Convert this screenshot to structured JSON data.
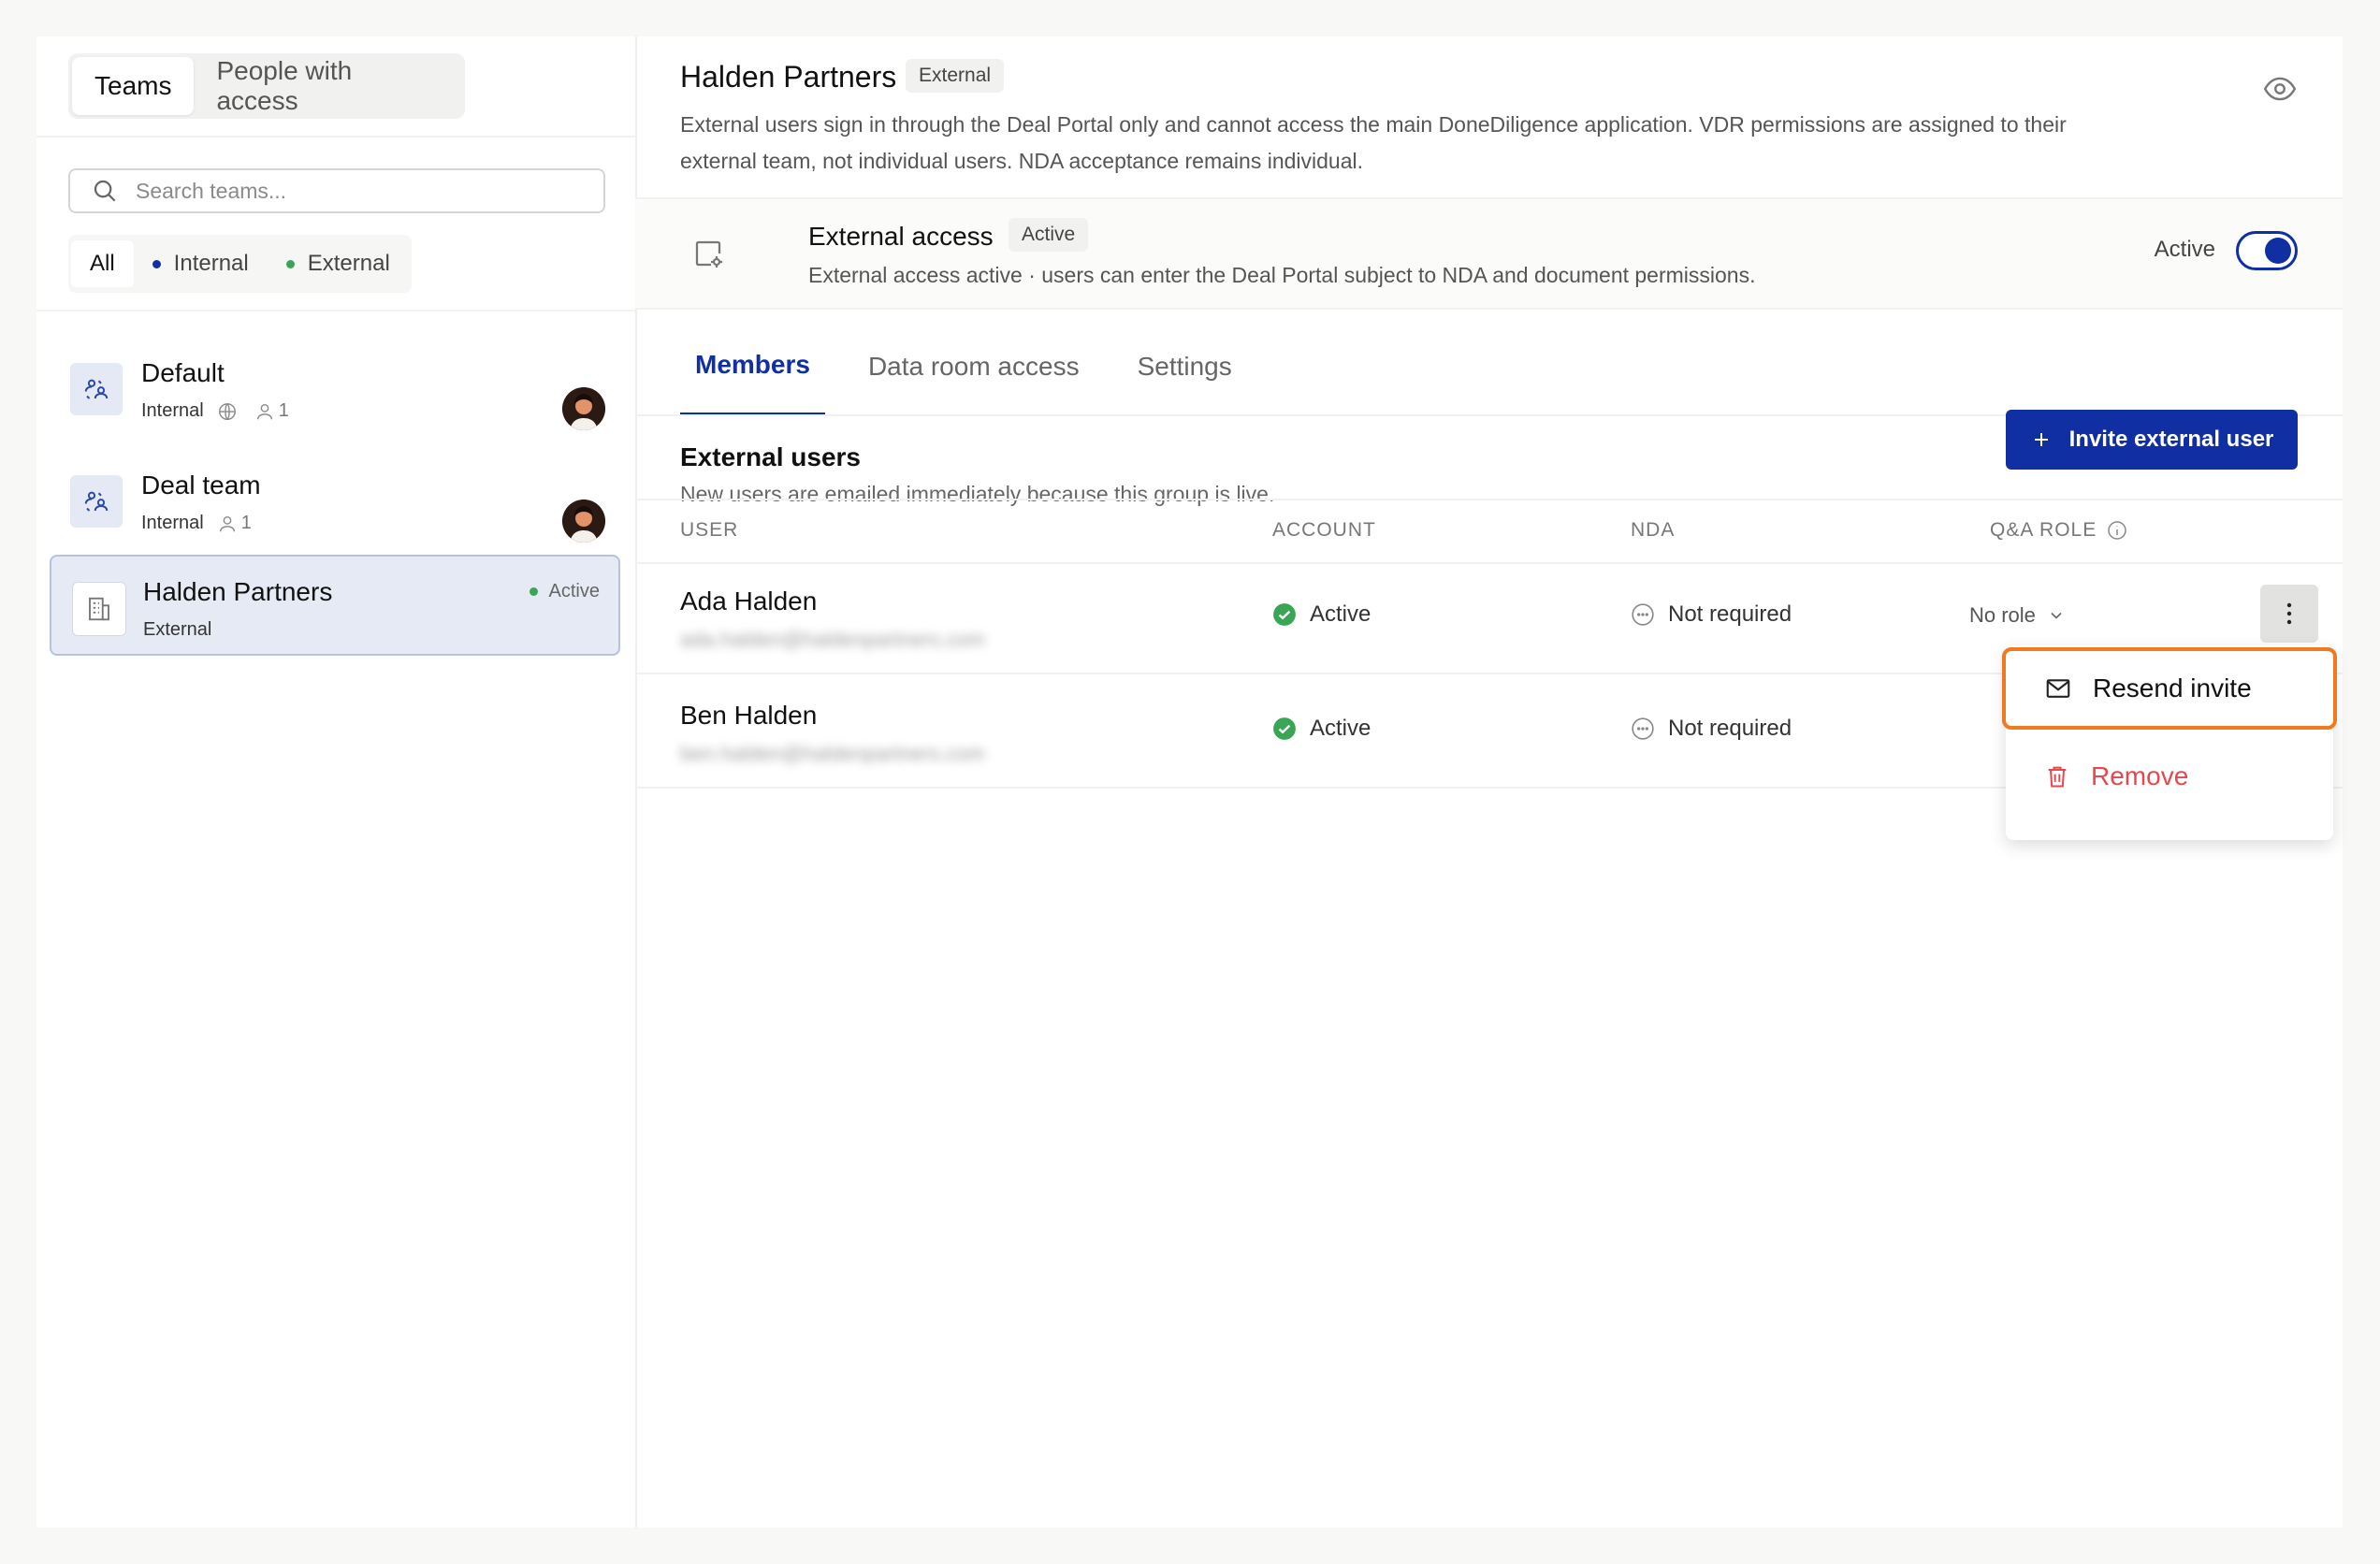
{
  "sidebar": {
    "tabs": [
      {
        "label": "Teams",
        "active": true
      },
      {
        "label": "People with access",
        "active": false
      }
    ],
    "search": {
      "placeholder": "Search teams..."
    },
    "filters": [
      {
        "label": "All",
        "active": true
      },
      {
        "label": "Internal",
        "dot_color": "#0f2fa3"
      },
      {
        "label": "External",
        "dot_color": "#3aa655"
      }
    ],
    "teams": [
      {
        "name": "Default",
        "type": "Internal",
        "member_count": "1",
        "icon": "users-icon",
        "has_globe": true
      },
      {
        "name": "Deal team",
        "type": "Internal",
        "member_count": "1",
        "icon": "users-icon"
      },
      {
        "name": "Halden Partners",
        "type": "External",
        "status": "Active",
        "icon": "building-icon",
        "selected": true
      }
    ]
  },
  "header": {
    "title": "Halden Partners",
    "badge": "External",
    "description": "External users sign in through the Deal Portal only and cannot access the main DoneDiligence application. VDR permissions are assigned to their external team, not individual users. NDA acceptance remains individual."
  },
  "access": {
    "title": "External access",
    "badge": "Active",
    "description": "External access active · users can enter the Deal Portal subject to NDA and document permissions.",
    "state_label": "Active",
    "enabled": true
  },
  "tabs": [
    {
      "label": "Members",
      "active": true
    },
    {
      "label": "Data room access",
      "active": false
    },
    {
      "label": "Settings",
      "active": false
    }
  ],
  "members": {
    "title": "External users",
    "description": "New users are emailed immediately because this group is live.",
    "invite_label": "Invite external user",
    "columns": [
      "USER",
      "ACCOUNT",
      "NDA",
      "Q&A ROLE"
    ],
    "rows": [
      {
        "name": "Ada Halden",
        "email": "ada.halden@haldenpartners.com",
        "account": "Active",
        "nda": "Not required",
        "role": "No role"
      },
      {
        "name": "Ben Halden",
        "email": "ben.halden@haldenpartners.com",
        "account": "Active",
        "nda": "Not required"
      }
    ]
  },
  "menu": {
    "items": [
      {
        "label": "Resend invite",
        "icon": "mail-icon"
      },
      {
        "label": "Remove",
        "icon": "trash-icon",
        "color": "#e5484d"
      }
    ]
  },
  "colors": {
    "accent": "#0f2fa3",
    "success": "#3aa655",
    "danger": "#e5484d",
    "highlight": "#f07a22"
  }
}
